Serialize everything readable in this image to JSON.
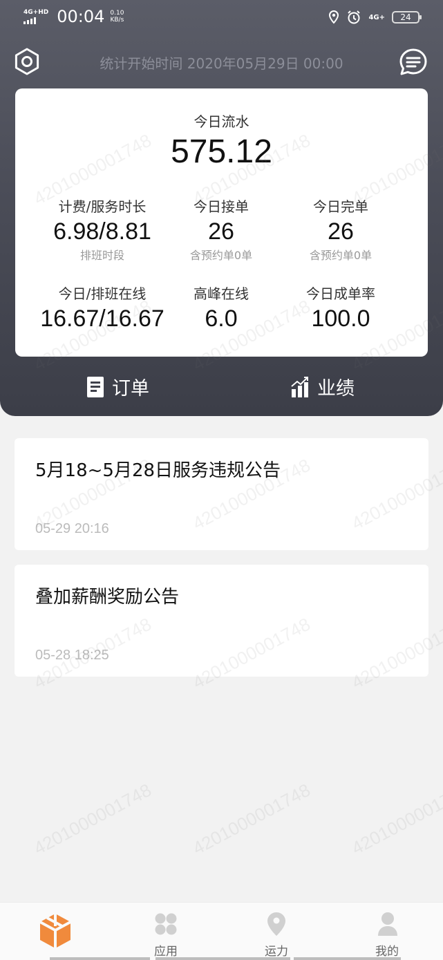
{
  "status_bar": {
    "network": "4G+HD",
    "time": "00:04",
    "speed_value": "0.10",
    "speed_unit": "KB/s",
    "network2": "4G+",
    "battery": "24"
  },
  "header": {
    "stats_start_time": "统计开始时间 2020年05月29日 00:00"
  },
  "summary": {
    "flow_label": "今日流水",
    "flow_value": "575.12",
    "stats": [
      {
        "label": "计费/服务时长",
        "value": "6.98/8.81",
        "sub": "排班时段"
      },
      {
        "label": "今日接单",
        "value": "26",
        "sub": "含预约单0单"
      },
      {
        "label": "今日完单",
        "value": "26",
        "sub": "含预约单0单"
      },
      {
        "label": "今日/排班在线",
        "value": "16.67/16.67",
        "sub": ""
      },
      {
        "label": "高峰在线",
        "value": "6.0",
        "sub": ""
      },
      {
        "label": "今日成单率",
        "value": "100.0",
        "sub": ""
      }
    ]
  },
  "tabs": {
    "orders_label": "订单",
    "performance_label": "业绩"
  },
  "notices": [
    {
      "title": "5月18~5月28日服务违规公告",
      "time": "05-29 20:16"
    },
    {
      "title": "叠加薪酬奖励公告",
      "time": "05-28 18:25"
    }
  ],
  "watermark_text": "4201000001748",
  "bottom_nav": {
    "home_label": "",
    "apps_label": "应用",
    "capacity_label": "运力",
    "mine_label": "我的"
  },
  "colors": {
    "header_bg": "#4b4d58",
    "accent": "#f08a3c"
  }
}
